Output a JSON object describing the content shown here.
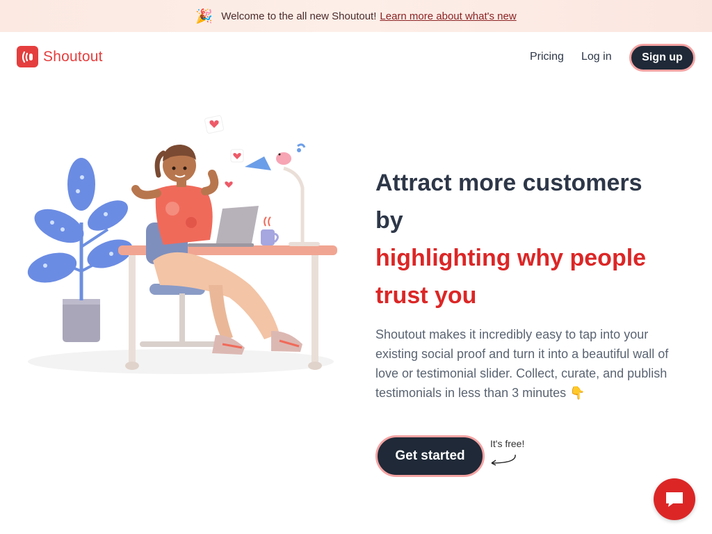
{
  "banner": {
    "icon": "party-popper-icon",
    "text": "Welcome to the all new Shoutout!",
    "link": "Learn more about what's new"
  },
  "nav": {
    "logo_icon": "shoutout-logo-icon",
    "logo_text": "Shoutout",
    "pricing": "Pricing",
    "login": "Log in",
    "signup": "Sign up"
  },
  "hero": {
    "headline_line1": "Attract more customers",
    "headline_line2": "by",
    "headline_line3": "highlighting why people",
    "headline_line4": "trust you",
    "description": "Shoutout makes it incredibly easy to tap into your existing social proof and turn it into a beautiful wall of love or testimonial slider. Collect, curate, and publish testimonials in less than 3 minutes 👇",
    "cta": "Get started",
    "cta_note": "It's free!"
  },
  "chat": {
    "icon": "chat-bubble-icon"
  },
  "colors": {
    "brand": "#e53e3e",
    "dark": "#1f2937",
    "accent_border": "#f4a3a3",
    "heading": "#2d3748",
    "highlight": "#dc2626"
  }
}
